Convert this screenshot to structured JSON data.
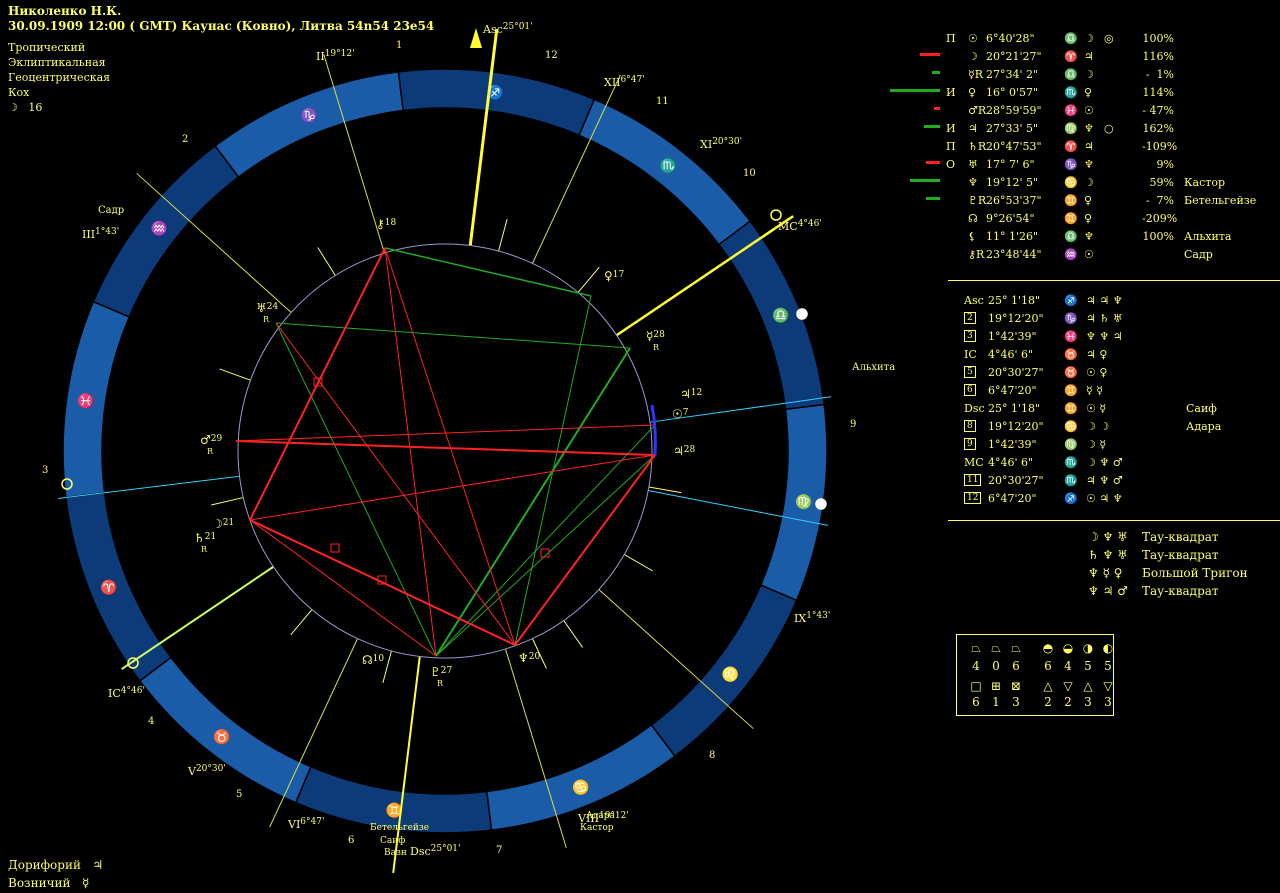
{
  "header": {
    "name": "Николенко Н.К.",
    "date_line": "30.09.1909  12:00 ( GMT) Каунас (Ковно), Литва 54n54  23e54",
    "zodiac": "Тропический",
    "coords": "Эклиптикальная",
    "center": "Геоцентрическая",
    "houses": "Кох",
    "moon_day_glyph": "☽",
    "moon_day": "16"
  },
  "colors": {
    "background": "#000000",
    "text": "#ffff66",
    "ring": "#1a5ca8",
    "ring_dark": "#0d3a78",
    "red_aspect": "#ff2222",
    "green_aspect": "#22aa22",
    "cusp_line": "#ffff33",
    "axis_cyan": "#33ccff"
  },
  "chart": {
    "house_numbers": [
      "1",
      "2",
      "3",
      "4",
      "5",
      "6",
      "7",
      "8",
      "9",
      "10",
      "11",
      "12"
    ],
    "sign_glyphs": [
      "♑",
      "♒",
      "♓",
      "♈",
      "♉",
      "♊",
      "♋",
      "♌",
      "♍",
      "♎",
      "♏",
      "♐"
    ],
    "cusp_labels": [
      {
        "id": "asc",
        "text": "Asc",
        "deg": "25°01'"
      },
      {
        "id": "ii",
        "text": "II",
        "deg": "19°12'"
      },
      {
        "id": "iii",
        "text": "III",
        "deg": "1°43'"
      },
      {
        "id": "ic",
        "text": "IC",
        "deg": "4°46'"
      },
      {
        "id": "v",
        "text": "V",
        "deg": "20°30'"
      },
      {
        "id": "vi",
        "text": "VI",
        "deg": "6°47'"
      },
      {
        "id": "dsc",
        "text": "Dsc",
        "deg": "25°01'"
      },
      {
        "id": "viii",
        "text": "VIII",
        "deg": "19°12'"
      },
      {
        "id": "ix",
        "text": "IX",
        "deg": "1°43'"
      },
      {
        "id": "mc",
        "text": "MC",
        "deg": "4°46'"
      },
      {
        "id": "xi",
        "text": "XI",
        "deg": "20°30'"
      },
      {
        "id": "xii",
        "text": "XII",
        "deg": "6°47'"
      }
    ],
    "planets": [
      {
        "id": "chiron",
        "glyph": "⚷",
        "num": "18"
      },
      {
        "id": "venus",
        "glyph": "♀",
        "num": "17"
      },
      {
        "id": "mercury",
        "glyph": "☿",
        "num": "28",
        "retro": "R"
      },
      {
        "id": "jupiter_small",
        "glyph": "♃",
        "num": "12"
      },
      {
        "id": "sun",
        "glyph": "☉",
        "num": "7"
      },
      {
        "id": "jupiter",
        "glyph": "♃",
        "num": "28"
      },
      {
        "id": "neptune",
        "glyph": "♆",
        "num": "20"
      },
      {
        "id": "pluto",
        "glyph": "♇",
        "num": "27",
        "retro": "R"
      },
      {
        "id": "node",
        "glyph": "☊",
        "num": "10"
      },
      {
        "id": "saturn",
        "glyph": "♄",
        "num": "21",
        "retro": "R"
      },
      {
        "id": "moon",
        "glyph": "☽",
        "num": "21"
      },
      {
        "id": "mars",
        "glyph": "♂",
        "num": "29",
        "retro": "R"
      },
      {
        "id": "uranus",
        "glyph": "♅",
        "num": "24",
        "retro": "R"
      }
    ],
    "stars": [
      {
        "id": "sadr",
        "text": "Садр"
      },
      {
        "id": "alhita",
        "text": "Альхита"
      },
      {
        "id": "betelgeuse",
        "text": "Бетельгейзе"
      },
      {
        "id": "saif",
        "text": "Саиф"
      },
      {
        "id": "vazn",
        "text": "Вазн"
      },
      {
        "id": "adara",
        "text": "Адара"
      },
      {
        "id": "kastor",
        "text": "Кастор"
      }
    ]
  },
  "planet_table": [
    {
      "status": "П",
      "glyph": "☉",
      "pos": "6°40'28\"",
      "zsign": "♎",
      "r1": "☽",
      "r2": "◎",
      "pct": "100%",
      "star": ""
    },
    {
      "status": "",
      "glyph": "☽",
      "pos": "20°21'27\"",
      "zsign": "♈",
      "r1": "♃",
      "r2": "",
      "pct": "116%",
      "star": ""
    },
    {
      "status": "",
      "glyph": "☿R",
      "pos": "27°34' 2\"",
      "zsign": "♎",
      "r1": "☽",
      "r2": "",
      "pct": "-  1%",
      "star": ""
    },
    {
      "status": "И",
      "glyph": "♀",
      "pos": "16° 0'57\"",
      "zsign": "♏",
      "r1": "♀",
      "r2": "",
      "pct": "114%",
      "star": ""
    },
    {
      "status": "",
      "glyph": "♂R",
      "pos": "28°59'59\"",
      "zsign": "♓",
      "r1": "☉",
      "r2": "",
      "pct": "- 47%",
      "star": ""
    },
    {
      "status": "И",
      "glyph": "♃",
      "pos": "27°33' 5\"",
      "zsign": "♍",
      "r1": "♆",
      "r2": "○",
      "pct": "162%",
      "star": ""
    },
    {
      "status": "П",
      "glyph": "♄R",
      "pos": "20°47'53\"",
      "zsign": "♈",
      "r1": "♃",
      "r2": "",
      "pct": "-109%",
      "star": ""
    },
    {
      "status": "О",
      "glyph": "♅",
      "pos": "17° 7' 6\"",
      "zsign": "♑",
      "r1": "♆",
      "r2": "",
      "pct": "9%",
      "star": ""
    },
    {
      "status": "",
      "glyph": "♆",
      "pos": "19°12' 5\"",
      "zsign": "♋",
      "r1": "☽",
      "r2": "",
      "pct": "59%",
      "star": "Кастор"
    },
    {
      "status": "",
      "glyph": "♇R",
      "pos": "26°53'37\"",
      "zsign": "♊",
      "r1": "♀",
      "r2": "",
      "pct": "-  7%",
      "star": "Бетельгейзе"
    },
    {
      "status": "",
      "glyph": "☊",
      "pos": "9°26'54\"",
      "zsign": "♊",
      "r1": "♀",
      "r2": "",
      "pct": "-209%",
      "star": ""
    },
    {
      "status": "",
      "glyph": "⚸",
      "pos": "11° 1'26\"",
      "zsign": "♎",
      "r1": "♆",
      "r2": "",
      "pct": "100%",
      "star": "Альхита"
    },
    {
      "status": "",
      "glyph": "⚷R",
      "pos": "23°48'44\"",
      "zsign": "♒",
      "r1": "☉",
      "r2": "",
      "pct": "",
      "star": "Садр"
    }
  ],
  "house_table": [
    {
      "label": "Asc",
      "pos": "25° 1'18\"",
      "zsign": "♐",
      "r": "♃ ♃ ♆",
      "star": ""
    },
    {
      "label": "2",
      "pos": "19°12'20\"",
      "zsign": "♑",
      "r": "♃ ♄ ♅",
      "star": ""
    },
    {
      "label": "3",
      "pos": "1°42'39\"",
      "zsign": "♓",
      "r": "♆ ♆ ♃",
      "star": ""
    },
    {
      "label": "IC",
      "pos": "4°46' 6\"",
      "zsign": "♉",
      "r": "♃ ♀",
      "star": ""
    },
    {
      "label": "5",
      "pos": "20°30'27\"",
      "zsign": "♉",
      "r": "☉ ♀",
      "star": ""
    },
    {
      "label": "6",
      "pos": "6°47'20\"",
      "zsign": "♊",
      "r": "☿ ☿",
      "star": ""
    },
    {
      "label": "Dsc",
      "pos": "25° 1'18\"",
      "zsign": "♊",
      "r": "☉ ☿",
      "star": "Саиф"
    },
    {
      "label": "8",
      "pos": "19°12'20\"",
      "zsign": "♋",
      "r": "☽ ☽",
      "star": "Адара"
    },
    {
      "label": "9",
      "pos": "1°42'39\"",
      "zsign": "♍",
      "r": "☽ ☿",
      "star": ""
    },
    {
      "label": "MC",
      "pos": "4°46' 6\"",
      "zsign": "♏",
      "r": "☽ ♆ ♂",
      "star": ""
    },
    {
      "label": "11",
      "pos": "20°30'27\"",
      "zsign": "♏",
      "r": "♃ ♆ ♂",
      "star": ""
    },
    {
      "label": "12",
      "pos": "6°47'20\"",
      "zsign": "♐",
      "r": "☉ ♃ ♆",
      "star": ""
    }
  ],
  "aspect_figures": [
    {
      "glyphs": "☽ ♆ ♅",
      "label": "Тау-квадрат"
    },
    {
      "glyphs": "♄ ♆ ♅",
      "label": "Тау-квадрат"
    },
    {
      "glyphs": "♆ ☿ ♀",
      "label": "Большой Тригон"
    },
    {
      "glyphs": "♆ ♃ ♂",
      "label": "Тау-квадрат"
    }
  ],
  "elements_box": {
    "row1_glyphs": [
      "⏢",
      "⏢",
      "⏢",
      "◓",
      "◒",
      "◑",
      "◐"
    ],
    "row1_vals": [
      "4",
      "0",
      "6",
      "6",
      "4",
      "5",
      "5"
    ],
    "row2_glyphs": [
      "□",
      "⊞",
      "⊠",
      "△",
      "▽",
      "△",
      "▽"
    ],
    "row2_vals": [
      "6",
      "1",
      "3",
      "2",
      "2",
      "3",
      "3"
    ]
  },
  "footer": {
    "doriphory_label": "Дорифорий",
    "doriphory_glyph": "♃",
    "voznichy_label": "Возничий",
    "voznichy_glyph": "☿"
  }
}
